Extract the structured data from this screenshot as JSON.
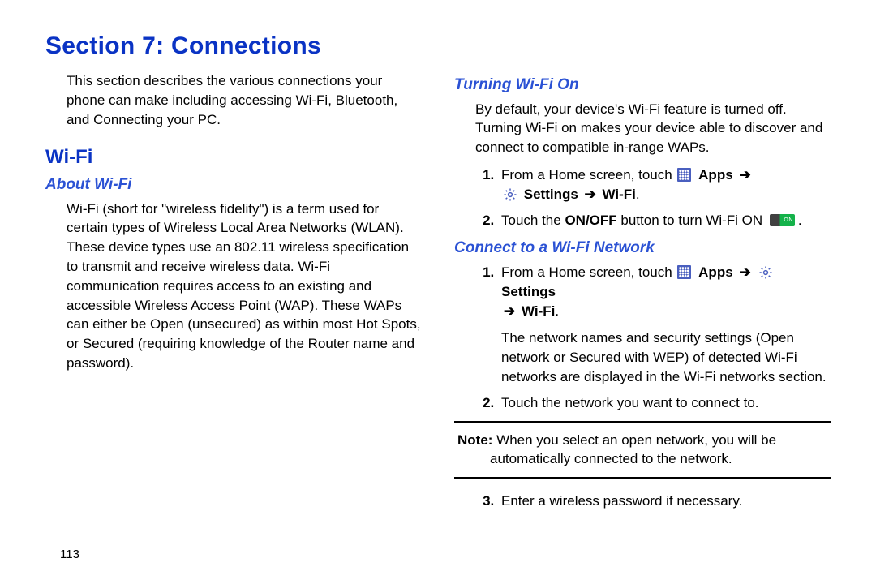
{
  "title": "Section 7: Connections",
  "page_number": "113",
  "intro": "This section describes the various connections your phone can make including accessing Wi-Fi, Bluetooth, and Connecting your PC.",
  "wifi": {
    "heading": "Wi-Fi",
    "about": {
      "heading": "About Wi-Fi",
      "text": "Wi-Fi (short for \"wireless fidelity\") is a term used for certain types of Wireless Local Area Networks (WLAN). These device types use an 802.11 wireless specification to transmit and receive wireless data. Wi-Fi communication requires access to an existing and accessible Wireless Access Point (WAP). These WAPs can either be Open (unsecured) as within most Hot Spots, or Secured (requiring knowledge of the Router name and password)."
    }
  },
  "turning_on": {
    "heading": "Turning Wi-Fi On",
    "text": "By default, your device's Wi-Fi feature is turned off. Turning Wi-Fi on makes your device able to discover and connect to compatible in-range WAPs.",
    "steps": {
      "s1_a": "From a Home screen, touch ",
      "s1_apps": "Apps",
      "s1_settings": "Settings",
      "s1_wifi": "Wi-Fi",
      "s2_a": "Touch the ",
      "s2_b": "ON/OFF",
      "s2_c": " button to turn Wi-Fi ON "
    }
  },
  "connect": {
    "heading": "Connect to a Wi-Fi Network",
    "steps": {
      "s1_a": "From a Home screen, touch ",
      "s1_apps": "Apps",
      "s1_settings": "Settings",
      "s1_wifi": "Wi-Fi",
      "s1_follow": "The network names and security settings (Open network or Secured with WEP) of detected Wi-Fi networks are displayed in the Wi-Fi networks section.",
      "s2": "Touch the network you want to connect to.",
      "note_label": "Note:",
      "note_text": " When you select an open network, you will be automatically connected to the network.",
      "s3": "Enter a wireless password if necessary."
    }
  },
  "arrow": "➔",
  "period": "."
}
